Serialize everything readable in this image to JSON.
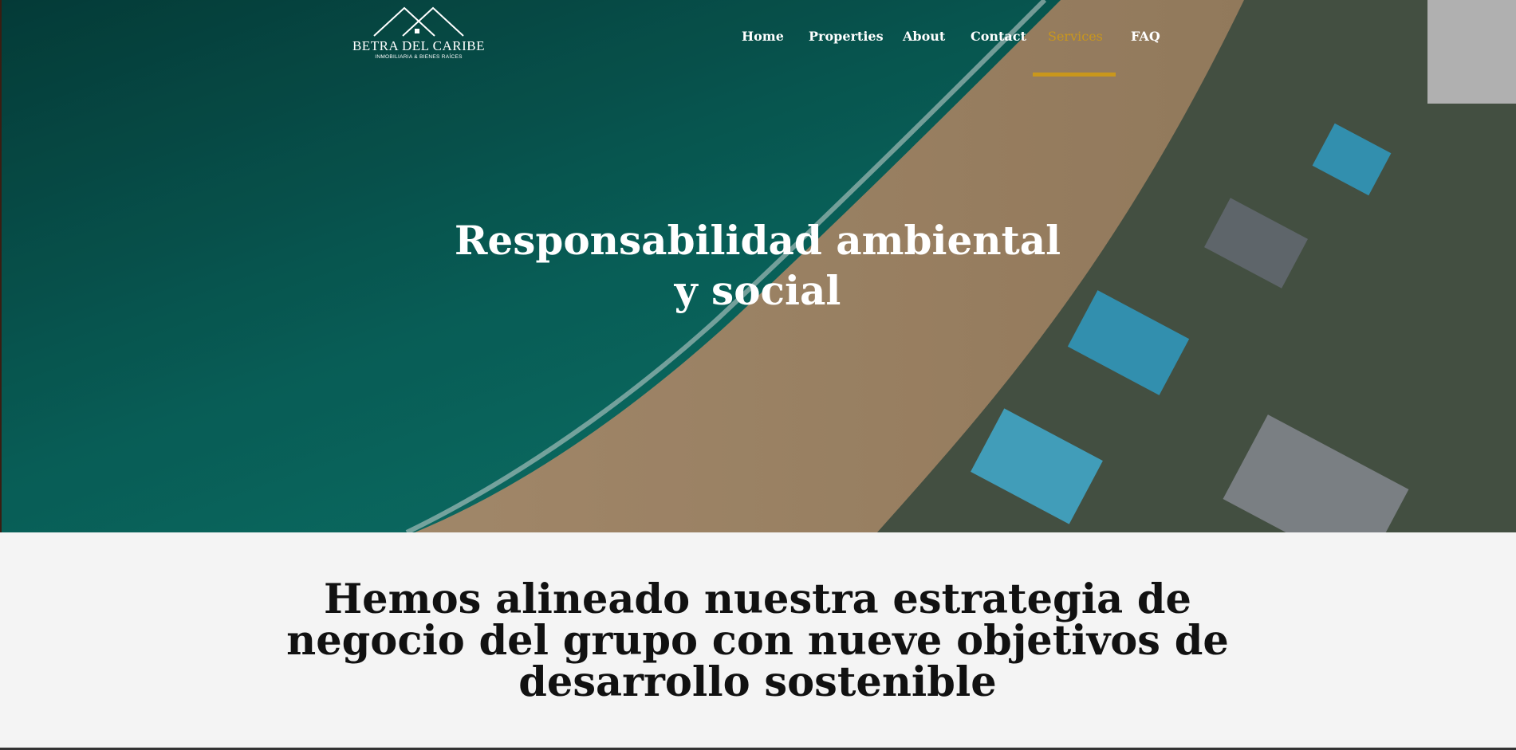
{
  "brand": {
    "name": "BETRA DEL CARIBE",
    "tagline": "INMOBILIARIA & BIENES RAÍCES",
    "logo_icon": "house-roofs-icon"
  },
  "nav": {
    "items": [
      {
        "label": "Home",
        "active": false
      },
      {
        "label": "Properties",
        "active": false
      },
      {
        "label": "About",
        "active": false
      },
      {
        "label": "Contact",
        "active": false
      },
      {
        "label": "Services",
        "active": true
      },
      {
        "label": "FAQ",
        "active": false
      }
    ],
    "accent_color": "#c9971c"
  },
  "hero": {
    "title": "Responsabilidad ambiental y social",
    "background": "aerial-beach-resort-photo"
  },
  "section": {
    "title": "Hemos alineado nuestra estrategia de negocio del grupo con nueve objetivos de desarrollo sostenible"
  }
}
